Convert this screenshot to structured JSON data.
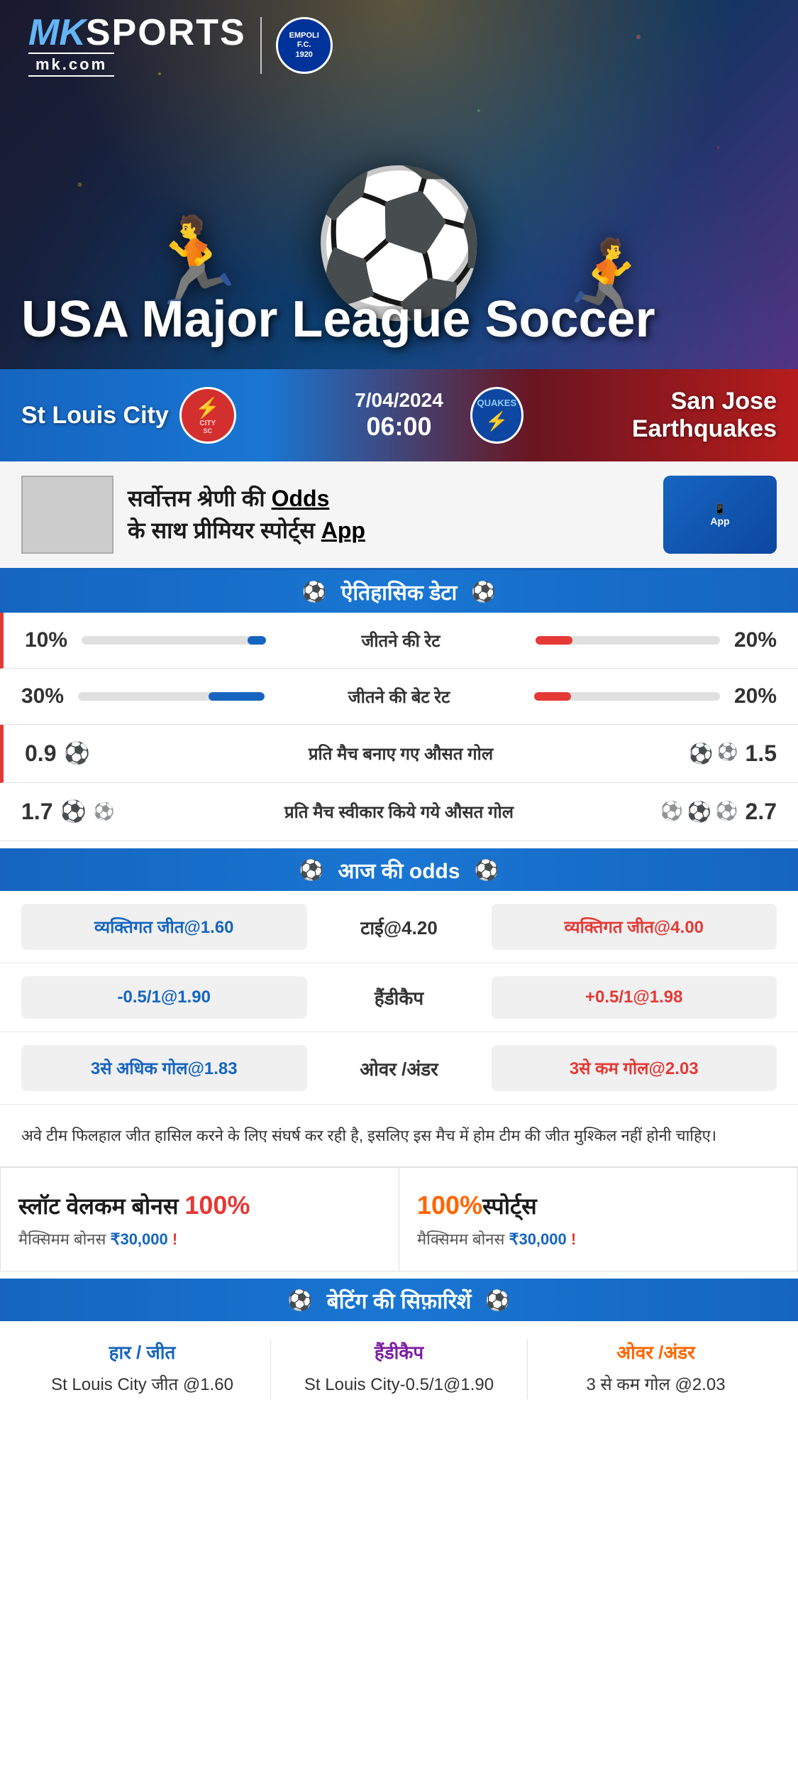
{
  "branding": {
    "mk": "MK",
    "sports": "SPORTS",
    "domain": "mk.com",
    "empoli_label": "EMPOLI F.C.\n1920"
  },
  "hero": {
    "title": "USA Major League Soccer"
  },
  "match": {
    "date": "7/04/2024",
    "time": "06:00",
    "home_team": "St Louis City",
    "away_team": "San Jose Earthquakes",
    "away_team_short": "QUAKES"
  },
  "promo": {
    "text": "सर्वोत्तम श्रेणी की Odds\nके साथ प्रीमियर स्पोर्ट्स App",
    "app_label": "App Preview"
  },
  "historical_header": "ऐतिहासिक डेटा",
  "stats": [
    {
      "label": "जीतने की रेट",
      "left_value": "10%",
      "left_pct": 10,
      "right_value": "20%",
      "right_pct": 20
    },
    {
      "label": "जीतने की बेट रेट",
      "left_value": "30%",
      "left_pct": 30,
      "right_value": "20%",
      "right_pct": 20
    }
  ],
  "goal_stats": [
    {
      "label": "प्रति मैच बनाए गए औसत गोल",
      "left_value": "0.9",
      "left_icons": 1,
      "right_value": "1.5",
      "right_icons": 2
    },
    {
      "label": "प्रति मैच स्वीकार किये गये औसत गोल",
      "left_value": "1.7",
      "left_icons": 2,
      "right_value": "2.7",
      "right_icons": 3
    }
  ],
  "odds_header": "आज की odds",
  "odds": [
    {
      "left": "व्यक्तिगत जीत@1.60",
      "center_label": "टाई@4.20",
      "right": "व्यक्तिगत जीत@4.00"
    },
    {
      "left": "-0.5/1@1.90",
      "center_label": "हैंडीकैप",
      "right": "+0.5/1@1.98"
    },
    {
      "left": "3से अधिक गोल@1.83",
      "center_label": "ओवर /अंडर",
      "right": "3से कम गोल@2.03"
    }
  ],
  "description": "अवे टीम फिलहाल जीत हासिल करने के लिए संघर्ष कर रही है, इसलिए इस मैच में होम टीम की जीत मुश्किल नहीं होनी चाहिए।",
  "bonus": [
    {
      "title_prefix": "स्लॉट वेलकम बोनस ",
      "title_highlight": "100%",
      "subtitle_prefix": "मैक्सिमम बोनस ₹",
      "subtitle_amount": "30,000",
      "subtitle_suffix": " !"
    },
    {
      "title_prefix": "",
      "title_highlight": "100%",
      "title_suffix": "स्पोर्ट्स",
      "subtitle_prefix": "मैक्सिमम बोनस  ₹",
      "subtitle_amount": "30,000",
      "subtitle_suffix": " !"
    }
  ],
  "betting_header": "बेटिंग की सिफ़ारिशें",
  "betting": [
    {
      "header": "हार / जीत",
      "header_color": "blue",
      "value": "St Louis City जीत @1.60"
    },
    {
      "header": "हैंडीकैप",
      "header_color": "purple",
      "value": "St Louis City-0.5/1@1.90"
    },
    {
      "header": "ओवर /अंडर",
      "header_color": "orange",
      "value": "3 से कम गोल @2.03"
    }
  ]
}
